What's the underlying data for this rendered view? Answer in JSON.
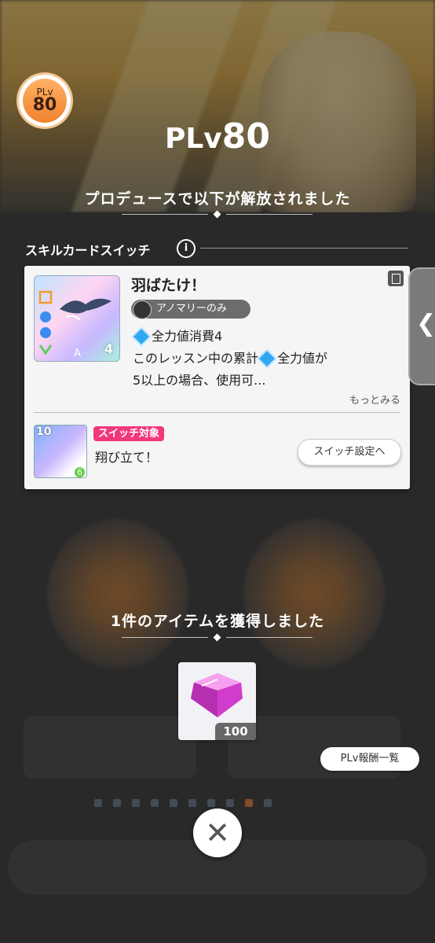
{
  "plv_badge": {
    "small": "PLv",
    "number": "80"
  },
  "plv_title": {
    "prefix": "PLv",
    "level": "80"
  },
  "unlock_message": "プロデュースで以下が解放されました",
  "section": {
    "label": "スキルカードスイッチ",
    "info_icon": "i"
  },
  "skill_card": {
    "title": "羽ばたけ！",
    "tag": "アノマリーのみ",
    "cost_line": "全力値消費4",
    "desc_line1": "このレッスン中の累計",
    "desc_line1b": "全力値が",
    "desc_line2": "5以上の場合、使用可...",
    "more": "もっとみる",
    "art_cost": "4",
    "art_letter": "A"
  },
  "switch_target": {
    "tag": "スイッチ対象",
    "name": "翔び立て！",
    "cost": "10",
    "sub": "6",
    "button": "スイッチ設定へ"
  },
  "acquired_message": "1件のアイテムを獲得しました",
  "item": {
    "quantity": "100",
    "icon": "gem-icon"
  },
  "reward_list_button": "PLv報酬一覧",
  "close_button": "✕",
  "side_tab_icon": "❮"
}
